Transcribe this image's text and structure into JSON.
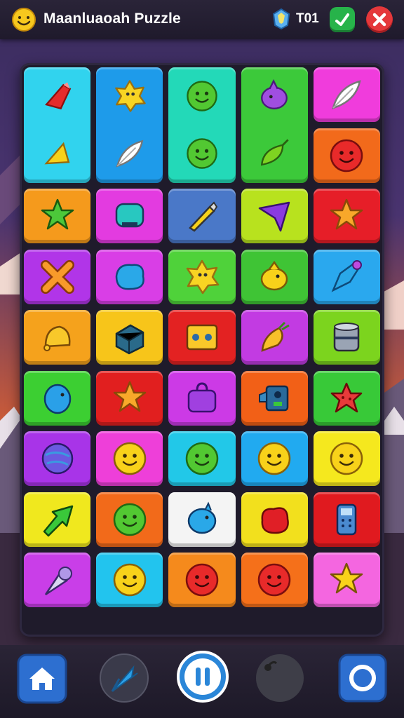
{
  "header": {
    "title": "Maanluaoah Puzzle",
    "score": "T01",
    "app_icon": "smiley-icon",
    "badge_icon": "gem-badge-icon",
    "confirm_icon": "check-icon",
    "close_icon": "close-icon"
  },
  "board": {
    "columns": 5,
    "tiles": [
      {
        "row": 0,
        "col": 0,
        "span": 2,
        "color": "#31d3ee",
        "icons": [
          "red-rocket-icon",
          "yellow-cone-icon"
        ]
      },
      {
        "row": 0,
        "col": 1,
        "span": 2,
        "color": "#1e9bea",
        "icons": [
          "yellow-star-blob-icon",
          "white-feather-icon"
        ]
      },
      {
        "row": 0,
        "col": 2,
        "span": 2,
        "color": "#23d9b8",
        "icons": [
          "green-smiley-icon",
          "green-smiley-icon"
        ]
      },
      {
        "row": 0,
        "col": 3,
        "span": 2,
        "color": "#3cc93a",
        "icons": [
          "purple-creature-icon",
          "green-leaf-icon"
        ]
      },
      {
        "row": 0,
        "col": 4,
        "span": 1,
        "color": "#f03cdc",
        "icons": [
          "white-feather-icon"
        ]
      },
      {
        "row": 1,
        "col": 4,
        "span": 1,
        "color": "#f26a1b",
        "icons": [
          "red-smiley-icon"
        ]
      },
      {
        "row": 2,
        "col": 0,
        "span": 1,
        "color": "#f59a1c",
        "icons": [
          "green-star-icon"
        ]
      },
      {
        "row": 2,
        "col": 1,
        "span": 1,
        "color": "#e33be0",
        "icons": [
          "teal-block-icon"
        ]
      },
      {
        "row": 2,
        "col": 2,
        "span": 1,
        "color": "#4a78c8",
        "icons": [
          "yellow-pen-icon"
        ]
      },
      {
        "row": 2,
        "col": 3,
        "span": 1,
        "color": "#b8e21e",
        "icons": [
          "purple-arrow-icon"
        ]
      },
      {
        "row": 2,
        "col": 4,
        "span": 1,
        "color": "#e61e28",
        "icons": [
          "orange-star-icon"
        ]
      },
      {
        "row": 3,
        "col": 0,
        "span": 1,
        "color": "#b135e8",
        "icons": [
          "orange-x-icon"
        ]
      },
      {
        "row": 3,
        "col": 1,
        "span": 1,
        "color": "#d93ee6",
        "icons": [
          "blue-blob-icon"
        ]
      },
      {
        "row": 3,
        "col": 2,
        "span": 1,
        "color": "#4fd23a",
        "icons": [
          "yellow-star-blob-icon"
        ]
      },
      {
        "row": 3,
        "col": 3,
        "span": 1,
        "color": "#3fc435",
        "icons": [
          "yellow-chick-icon"
        ]
      },
      {
        "row": 3,
        "col": 4,
        "span": 1,
        "color": "#2aa8ee",
        "icons": [
          "blue-rocket-icon"
        ]
      },
      {
        "row": 4,
        "col": 0,
        "span": 1,
        "color": "#f5a21c",
        "icons": [
          "yellow-bell-icon"
        ]
      },
      {
        "row": 4,
        "col": 1,
        "span": 1,
        "color": "#f7c51a",
        "icons": [
          "blue-box-icon"
        ]
      },
      {
        "row": 4,
        "col": 2,
        "span": 1,
        "color": "#e32222",
        "icons": [
          "yellow-card-icon"
        ]
      },
      {
        "row": 4,
        "col": 3,
        "span": 1,
        "color": "#c23be2",
        "icons": [
          "yellow-carrot-icon"
        ]
      },
      {
        "row": 4,
        "col": 4,
        "span": 1,
        "color": "#7cd41e",
        "icons": [
          "gray-can-icon"
        ]
      },
      {
        "row": 5,
        "col": 0,
        "span": 1,
        "color": "#3ccf32",
        "icons": [
          "blue-egg-icon"
        ]
      },
      {
        "row": 5,
        "col": 1,
        "span": 1,
        "color": "#e11f1f",
        "icons": [
          "orange-star-icon"
        ]
      },
      {
        "row": 5,
        "col": 2,
        "span": 1,
        "color": "#cc3ae6",
        "icons": [
          "purple-bag-icon"
        ]
      },
      {
        "row": 5,
        "col": 3,
        "span": 1,
        "color": "#f26017",
        "icons": [
          "blue-camera-icon"
        ]
      },
      {
        "row": 5,
        "col": 4,
        "span": 1,
        "color": "#38c938",
        "icons": [
          "red-starfish-icon"
        ]
      },
      {
        "row": 6,
        "col": 0,
        "span": 1,
        "color": "#a834e8",
        "icons": [
          "purple-planet-icon"
        ]
      },
      {
        "row": 6,
        "col": 1,
        "span": 1,
        "color": "#ee3fd9",
        "icons": [
          "yellow-smiley-icon"
        ]
      },
      {
        "row": 6,
        "col": 2,
        "span": 1,
        "color": "#22c8e8",
        "icons": [
          "green-smiley-icon"
        ]
      },
      {
        "row": 6,
        "col": 3,
        "span": 1,
        "color": "#21aaf0",
        "icons": [
          "yellow-smiley-icon"
        ]
      },
      {
        "row": 6,
        "col": 4,
        "span": 1,
        "color": "#f5e81e",
        "icons": [
          "yellow-smiley-icon"
        ]
      },
      {
        "row": 7,
        "col": 0,
        "span": 1,
        "color": "#f0e81e",
        "icons": [
          "green-arrow-icon"
        ]
      },
      {
        "row": 7,
        "col": 1,
        "span": 1,
        "color": "#f26a1a",
        "icons": [
          "green-smiley-icon"
        ]
      },
      {
        "row": 7,
        "col": 2,
        "span": 1,
        "color": "#f4f4f4",
        "icons": [
          "blue-bird-icon"
        ]
      },
      {
        "row": 7,
        "col": 3,
        "span": 1,
        "color": "#f2e01d",
        "icons": [
          "red-blob-icon"
        ]
      },
      {
        "row": 7,
        "col": 4,
        "span": 1,
        "color": "#e01a1f",
        "icons": [
          "blue-phone-icon"
        ]
      },
      {
        "row": 8,
        "col": 0,
        "span": 1,
        "color": "#c93ee8",
        "icons": [
          "ice-cream-icon"
        ]
      },
      {
        "row": 8,
        "col": 1,
        "span": 1,
        "color": "#22c4ee",
        "icons": [
          "yellow-smiley-icon"
        ]
      },
      {
        "row": 8,
        "col": 2,
        "span": 1,
        "color": "#f58a1c",
        "icons": [
          "red-smiley-icon"
        ]
      },
      {
        "row": 8,
        "col": 3,
        "span": 1,
        "color": "#f5701a",
        "icons": [
          "red-smiley-icon"
        ]
      },
      {
        "row": 8,
        "col": 4,
        "span": 1,
        "color": "#f466e0",
        "icons": [
          "yellow-star-icon"
        ]
      }
    ]
  },
  "footer": {
    "buttons": [
      {
        "id": "home",
        "icon": "home-icon"
      },
      {
        "id": "hint",
        "icon": "arrow-hint-icon"
      },
      {
        "id": "pause",
        "icon": "pause-icon"
      },
      {
        "id": "bomb",
        "icon": "bomb-icon"
      },
      {
        "id": "restart",
        "icon": "ring-icon"
      }
    ]
  }
}
